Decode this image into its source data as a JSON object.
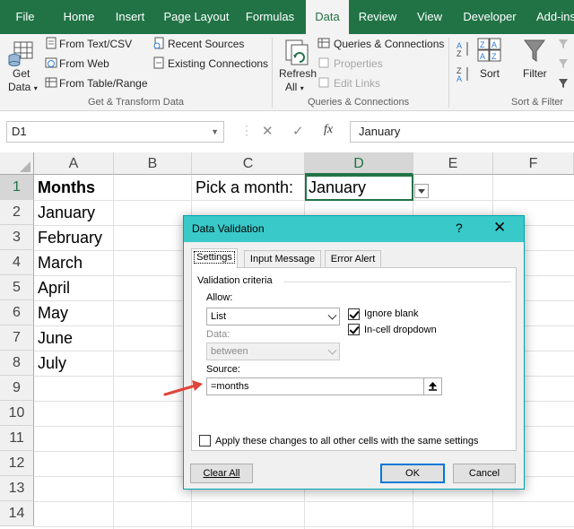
{
  "ribbon_tabs": [
    {
      "label": "File"
    },
    {
      "label": "Home"
    },
    {
      "label": "Insert"
    },
    {
      "label": "Page Layout"
    },
    {
      "label": "Formulas"
    },
    {
      "label": "Data",
      "active": true
    },
    {
      "label": "Review"
    },
    {
      "label": "View"
    },
    {
      "label": "Developer"
    },
    {
      "label": "Add-ins"
    }
  ],
  "ribbon": {
    "get_transform": {
      "get_data_label": "Get",
      "get_data_label2": "Data",
      "from_text_csv": "From Text/CSV",
      "from_web": "From Web",
      "from_table_range": "From Table/Range",
      "recent_sources": "Recent Sources",
      "existing_connections": "Existing Connections",
      "group_label": "Get & Transform Data"
    },
    "queries": {
      "refresh_all_label": "Refresh",
      "refresh_all_label2": "All",
      "queries_connections": "Queries & Connections",
      "properties": "Properties",
      "edit_links": "Edit Links",
      "group_label": "Queries & Connections"
    },
    "sort_filter": {
      "sort_label": "Sort",
      "filter_label": "Filter",
      "group_label": "Sort & Filter"
    }
  },
  "formula_bar": {
    "name_box": "D1",
    "fx_symbol": "fx",
    "formula": "January"
  },
  "grid": {
    "columns": [
      "A",
      "B",
      "C",
      "D",
      "E",
      "F"
    ],
    "selected_column": "D",
    "rows": [
      "1",
      "2",
      "3",
      "4",
      "5",
      "6",
      "7",
      "8",
      "9",
      "10",
      "11",
      "12",
      "13",
      "14"
    ],
    "selected_row": "1",
    "cells": {
      "A1": "Months",
      "A2": "January",
      "A3": "February",
      "A4": "March",
      "A5": "April",
      "A6": "May",
      "A7": "June",
      "A8": "July",
      "C1": "Pick a month:",
      "D1": "January"
    }
  },
  "dialog": {
    "title": "Data Validation",
    "help": "?",
    "close": "✕",
    "tabs": [
      {
        "label": "Settings",
        "active": true
      },
      {
        "label": "Input Message"
      },
      {
        "label": "Error Alert"
      }
    ],
    "section_title": "Validation criteria",
    "allow_label": "Allow:",
    "allow_value": "List",
    "data_label": "Data:",
    "data_value": "between",
    "ignore_blank_label": "Ignore blank",
    "ignore_blank_checked": true,
    "in_cell_dropdown_label": "In-cell dropdown",
    "in_cell_dropdown_checked": true,
    "source_label": "Source:",
    "source_value": "=months",
    "apply_all_label": "Apply these changes to all other cells with the same settings",
    "apply_all_checked": false,
    "clear_all_button": "Clear All",
    "ok_button": "OK",
    "cancel_button": "Cancel"
  },
  "colors": {
    "excel_green": "#217346",
    "dialog_title": "#39c9c9",
    "annotation_arrow": "#e0443a"
  }
}
